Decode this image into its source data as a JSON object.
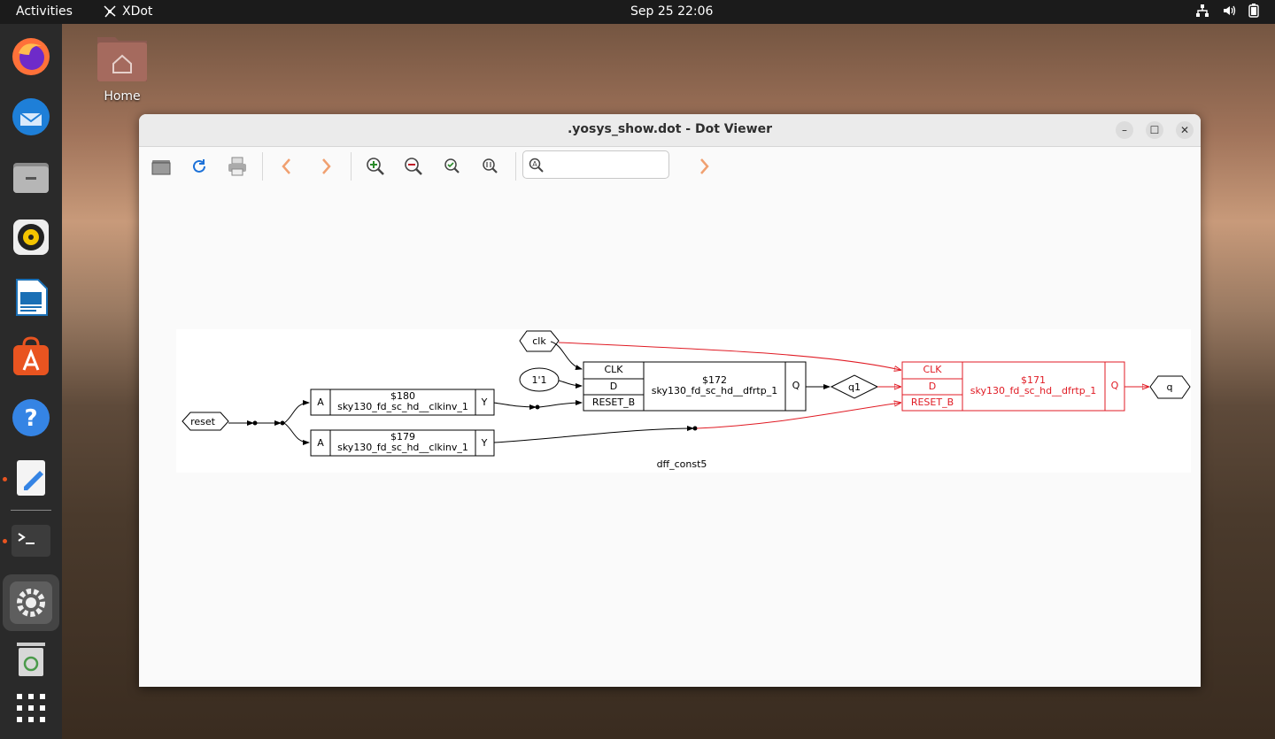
{
  "topbar": {
    "activities": "Activities",
    "app_name": "XDot",
    "clock": "Sep 25  22:06"
  },
  "desktop": {
    "home_label": "Home"
  },
  "window": {
    "title": ".yosys_show.dot - Dot Viewer",
    "minimize": "–",
    "maximize": "☐",
    "close": "✕"
  },
  "search": {
    "value": "",
    "placeholder": ""
  },
  "graph": {
    "caption": "dff_const5",
    "inputs": {
      "reset": "reset",
      "clk": "clk",
      "const": "1'1"
    },
    "cell180": {
      "id": "$180",
      "type": "sky130_fd_sc_hd__clkinv_1",
      "in": "A",
      "out": "Y"
    },
    "cell179": {
      "id": "$179",
      "type": "sky130_fd_sc_hd__clkinv_1",
      "in": "A",
      "out": "Y"
    },
    "cell172": {
      "id": "$172",
      "type": "sky130_fd_sc_hd__dfrtp_1",
      "clk": "CLK",
      "d": "D",
      "reset": "RESET_B",
      "q": "Q"
    },
    "cell171": {
      "id": "$171",
      "type": "sky130_fd_sc_hd__dfrtp_1",
      "clk": "CLK",
      "d": "D",
      "reset": "RESET_B",
      "q": "Q"
    },
    "wire_q1": "q1",
    "output_q": "q",
    "highlight_color": "#e01b24"
  }
}
